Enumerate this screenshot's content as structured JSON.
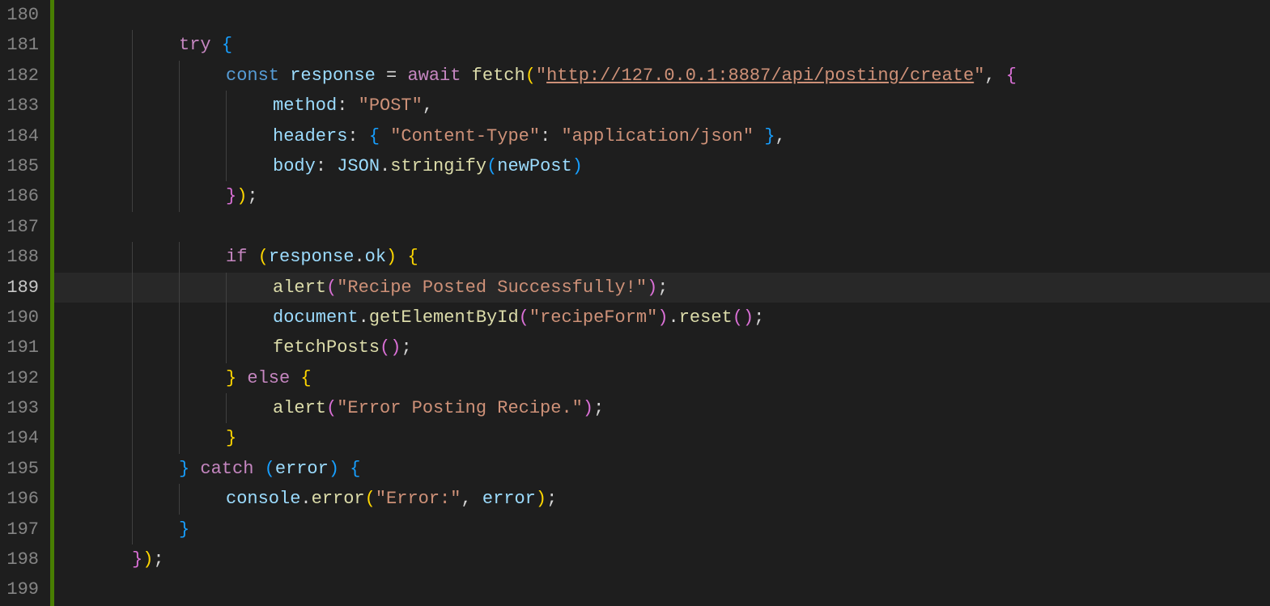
{
  "lines": [
    {
      "no": "180",
      "indent": 0,
      "tokens": []
    },
    {
      "no": "181",
      "indent": 2,
      "tokens": [
        {
          "t": "try",
          "c": "tok-ctrl"
        },
        {
          "t": " ",
          "c": ""
        },
        {
          "t": "{",
          "c": "tok-brace2"
        }
      ]
    },
    {
      "no": "182",
      "indent": 3,
      "tokens": [
        {
          "t": "const",
          "c": "tok-const"
        },
        {
          "t": " ",
          "c": ""
        },
        {
          "t": "response",
          "c": "tok-var"
        },
        {
          "t": " ",
          "c": ""
        },
        {
          "t": "=",
          "c": "tok-op"
        },
        {
          "t": " ",
          "c": ""
        },
        {
          "t": "await",
          "c": "tok-ctrl"
        },
        {
          "t": " ",
          "c": ""
        },
        {
          "t": "fetch",
          "c": "tok-func"
        },
        {
          "t": "(",
          "c": "tok-brace0"
        },
        {
          "t": "\"",
          "c": "tok-str"
        },
        {
          "t": "http://127.0.0.1:8887/api/posting/create",
          "c": "tok-str underline"
        },
        {
          "t": "\"",
          "c": "tok-str"
        },
        {
          "t": ",",
          "c": "tok-punct"
        },
        {
          "t": " ",
          "c": ""
        },
        {
          "t": "{",
          "c": "tok-brace1"
        }
      ]
    },
    {
      "no": "183",
      "indent": 4,
      "tokens": [
        {
          "t": "method",
          "c": "tok-prop"
        },
        {
          "t": ":",
          "c": "tok-punct"
        },
        {
          "t": " ",
          "c": ""
        },
        {
          "t": "\"POST\"",
          "c": "tok-str"
        },
        {
          "t": ",",
          "c": "tok-punct"
        }
      ]
    },
    {
      "no": "184",
      "indent": 4,
      "tokens": [
        {
          "t": "headers",
          "c": "tok-prop"
        },
        {
          "t": ":",
          "c": "tok-punct"
        },
        {
          "t": " ",
          "c": ""
        },
        {
          "t": "{",
          "c": "tok-brace2"
        },
        {
          "t": " ",
          "c": ""
        },
        {
          "t": "\"Content-Type\"",
          "c": "tok-str"
        },
        {
          "t": ":",
          "c": "tok-punct"
        },
        {
          "t": " ",
          "c": ""
        },
        {
          "t": "\"application/json\"",
          "c": "tok-str"
        },
        {
          "t": " ",
          "c": ""
        },
        {
          "t": "}",
          "c": "tok-brace2"
        },
        {
          "t": ",",
          "c": "tok-punct"
        }
      ]
    },
    {
      "no": "185",
      "indent": 4,
      "tokens": [
        {
          "t": "body",
          "c": "tok-prop"
        },
        {
          "t": ":",
          "c": "tok-punct"
        },
        {
          "t": " ",
          "c": ""
        },
        {
          "t": "JSON",
          "c": "tok-var"
        },
        {
          "t": ".",
          "c": "tok-punct"
        },
        {
          "t": "stringify",
          "c": "tok-func"
        },
        {
          "t": "(",
          "c": "tok-brace2"
        },
        {
          "t": "newPost",
          "c": "tok-var"
        },
        {
          "t": ")",
          "c": "tok-brace2"
        }
      ]
    },
    {
      "no": "186",
      "indent": 3,
      "tokens": [
        {
          "t": "}",
          "c": "tok-brace1"
        },
        {
          "t": ")",
          "c": "tok-brace0"
        },
        {
          "t": ";",
          "c": "tok-punct"
        }
      ]
    },
    {
      "no": "187",
      "indent": 0,
      "tokens": []
    },
    {
      "no": "188",
      "indent": 3,
      "tokens": [
        {
          "t": "if",
          "c": "tok-ctrl"
        },
        {
          "t": " ",
          "c": ""
        },
        {
          "t": "(",
          "c": "tok-brace0"
        },
        {
          "t": "response",
          "c": "tok-var"
        },
        {
          "t": ".",
          "c": "tok-punct"
        },
        {
          "t": "ok",
          "c": "tok-prop"
        },
        {
          "t": ")",
          "c": "tok-brace0"
        },
        {
          "t": " ",
          "c": ""
        },
        {
          "t": "{",
          "c": "tok-brace0"
        }
      ]
    },
    {
      "no": "189",
      "indent": 4,
      "current": true,
      "tokens": [
        {
          "t": "alert",
          "c": "tok-func"
        },
        {
          "t": "(",
          "c": "tok-brace1"
        },
        {
          "t": "\"Recipe Posted Successfully!\"",
          "c": "tok-str"
        },
        {
          "t": ")",
          "c": "tok-brace1"
        },
        {
          "t": ";",
          "c": "tok-punct"
        }
      ]
    },
    {
      "no": "190",
      "indent": 4,
      "tokens": [
        {
          "t": "document",
          "c": "tok-var"
        },
        {
          "t": ".",
          "c": "tok-punct"
        },
        {
          "t": "getElementById",
          "c": "tok-func"
        },
        {
          "t": "(",
          "c": "tok-brace1"
        },
        {
          "t": "\"recipeForm\"",
          "c": "tok-str"
        },
        {
          "t": ")",
          "c": "tok-brace1"
        },
        {
          "t": ".",
          "c": "tok-punct"
        },
        {
          "t": "reset",
          "c": "tok-func"
        },
        {
          "t": "(",
          "c": "tok-brace1"
        },
        {
          "t": ")",
          "c": "tok-brace1"
        },
        {
          "t": ";",
          "c": "tok-punct"
        }
      ]
    },
    {
      "no": "191",
      "indent": 4,
      "tokens": [
        {
          "t": "fetchPosts",
          "c": "tok-func"
        },
        {
          "t": "(",
          "c": "tok-brace1"
        },
        {
          "t": ")",
          "c": "tok-brace1"
        },
        {
          "t": ";",
          "c": "tok-punct"
        }
      ]
    },
    {
      "no": "192",
      "indent": 3,
      "tokens": [
        {
          "t": "}",
          "c": "tok-brace0"
        },
        {
          "t": " ",
          "c": ""
        },
        {
          "t": "else",
          "c": "tok-ctrl"
        },
        {
          "t": " ",
          "c": ""
        },
        {
          "t": "{",
          "c": "tok-brace0"
        }
      ]
    },
    {
      "no": "193",
      "indent": 4,
      "tokens": [
        {
          "t": "alert",
          "c": "tok-func"
        },
        {
          "t": "(",
          "c": "tok-brace1"
        },
        {
          "t": "\"Error Posting Recipe.\"",
          "c": "tok-str"
        },
        {
          "t": ")",
          "c": "tok-brace1"
        },
        {
          "t": ";",
          "c": "tok-punct"
        }
      ]
    },
    {
      "no": "194",
      "indent": 3,
      "tokens": [
        {
          "t": "}",
          "c": "tok-brace0"
        }
      ]
    },
    {
      "no": "195",
      "indent": 2,
      "tokens": [
        {
          "t": "}",
          "c": "tok-brace2"
        },
        {
          "t": " ",
          "c": ""
        },
        {
          "t": "catch",
          "c": "tok-ctrl"
        },
        {
          "t": " ",
          "c": ""
        },
        {
          "t": "(",
          "c": "tok-brace2"
        },
        {
          "t": "error",
          "c": "tok-var"
        },
        {
          "t": ")",
          "c": "tok-brace2"
        },
        {
          "t": " ",
          "c": ""
        },
        {
          "t": "{",
          "c": "tok-brace2"
        }
      ]
    },
    {
      "no": "196",
      "indent": 3,
      "tokens": [
        {
          "t": "console",
          "c": "tok-var"
        },
        {
          "t": ".",
          "c": "tok-punct"
        },
        {
          "t": "error",
          "c": "tok-func"
        },
        {
          "t": "(",
          "c": "tok-brace0"
        },
        {
          "t": "\"Error:\"",
          "c": "tok-str"
        },
        {
          "t": ",",
          "c": "tok-punct"
        },
        {
          "t": " ",
          "c": ""
        },
        {
          "t": "error",
          "c": "tok-var"
        },
        {
          "t": ")",
          "c": "tok-brace0"
        },
        {
          "t": ";",
          "c": "tok-punct"
        }
      ]
    },
    {
      "no": "197",
      "indent": 2,
      "tokens": [
        {
          "t": "}",
          "c": "tok-brace2"
        }
      ]
    },
    {
      "no": "198",
      "indent": 1,
      "tokens": [
        {
          "t": "}",
          "c": "tok-brace1"
        },
        {
          "t": ")",
          "c": "tok-brace0"
        },
        {
          "t": ";",
          "c": "tok-punct"
        }
      ]
    },
    {
      "no": "199",
      "indent": 0,
      "tokens": []
    }
  ],
  "indentWidth": 58,
  "leftPad": 38,
  "guideColumns": [
    1,
    2,
    3
  ]
}
